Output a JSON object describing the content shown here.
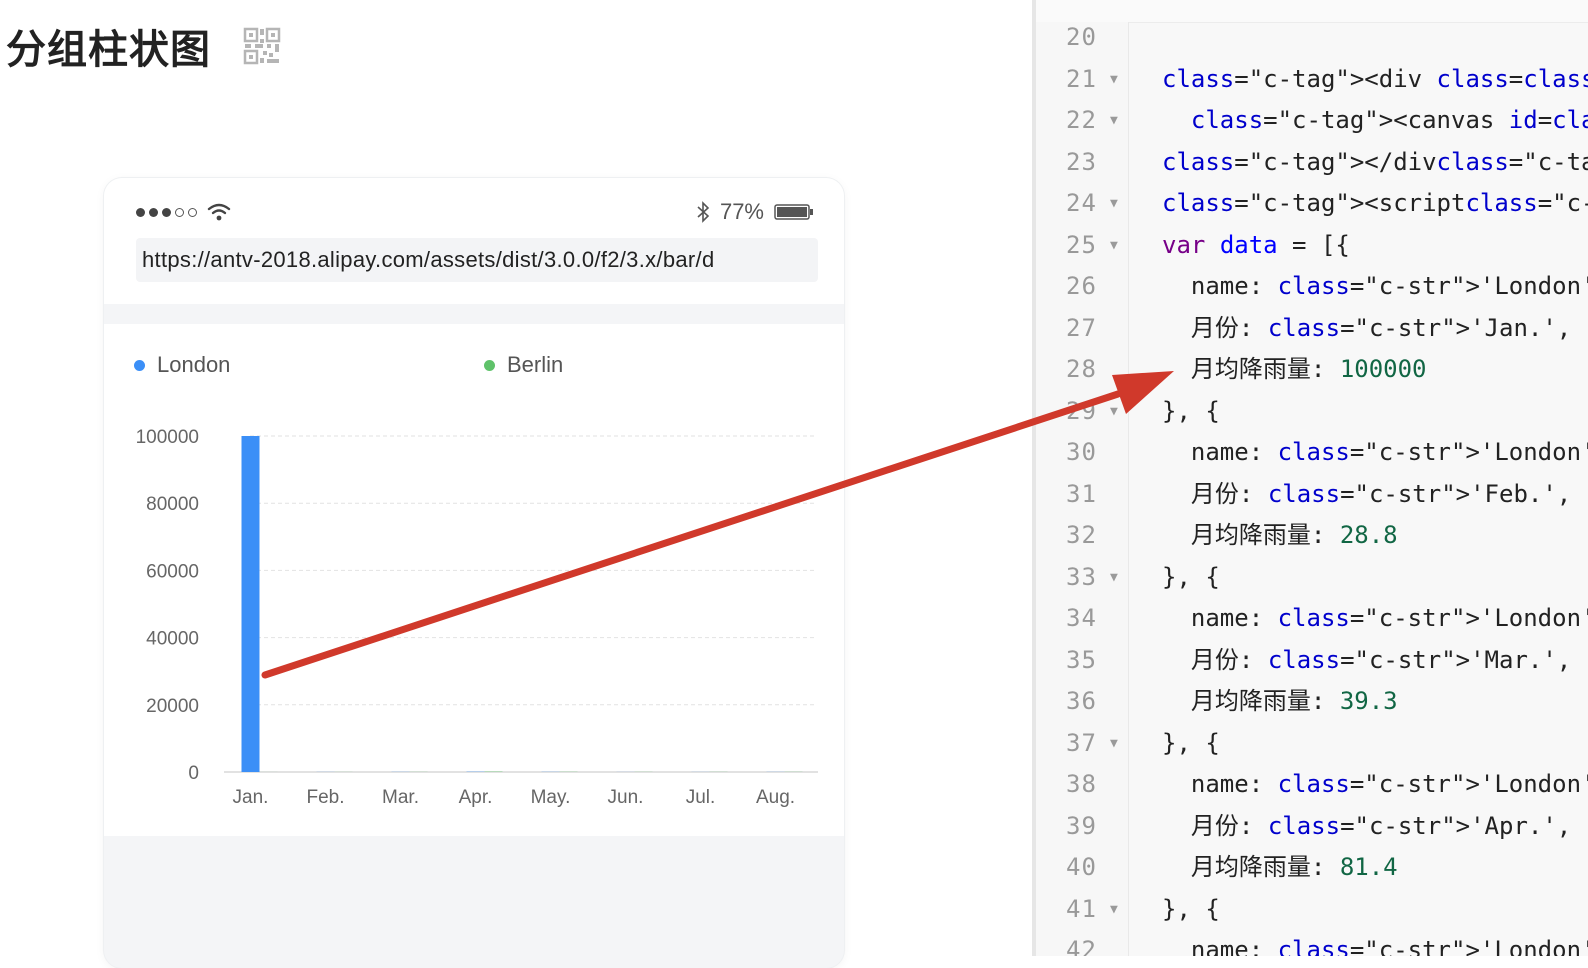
{
  "page": {
    "title": "分组柱状图",
    "qr_icon": "qr-code-icon"
  },
  "phone": {
    "status": {
      "signal_icon": "signal-dots-icon",
      "wifi_icon": "wifi-icon",
      "bluetooth_icon": "bluetooth-icon",
      "battery": "77%",
      "battery_icon": "battery-icon"
    },
    "url": "https://antv-2018.alipay.com/assets/dist/3.0.0/f2/3.x/bar/d"
  },
  "chart_data": {
    "type": "bar",
    "categories": [
      "Jan.",
      "Feb.",
      "Mar.",
      "Apr.",
      "May.",
      "Jun.",
      "Jul.",
      "Aug."
    ],
    "series": [
      {
        "name": "London",
        "color": "#3b8ff7",
        "values": [
          100000,
          28.8,
          39.3,
          81.4,
          47,
          20.3,
          24,
          35.6
        ]
      },
      {
        "name": "Berlin",
        "color": "#5fc26a",
        "values": [
          12.4,
          23.2,
          34.5,
          99.7,
          52.6,
          35.5,
          37.4,
          42.4
        ]
      }
    ],
    "yticks": [
      0,
      20000,
      40000,
      60000,
      80000,
      100000
    ],
    "ylim": [
      0,
      100000
    ],
    "grid": true,
    "legend_position": "top"
  },
  "code": {
    "lines": [
      {
        "num": "20",
        "fold": "",
        "text": ""
      },
      {
        "num": "21",
        "fold": "▼",
        "text": "<div class=\"chart-wrapper\">"
      },
      {
        "num": "22",
        "fold": "▼",
        "text": "  <canvas id=\"mountNode\">"
      },
      {
        "num": "23",
        "fold": "",
        "text": "</div>"
      },
      {
        "num": "24",
        "fold": "▼",
        "text": "<script>"
      },
      {
        "num": "25",
        "fold": "▼",
        "text": "var data = [{"
      },
      {
        "num": "26",
        "fold": "",
        "text": "  name: 'London',"
      },
      {
        "num": "27",
        "fold": "",
        "text": "  月份: 'Jan.',"
      },
      {
        "num": "28",
        "fold": "",
        "text": "  月均降雨量: 100000"
      },
      {
        "num": "29",
        "fold": "▼",
        "text": "}, {"
      },
      {
        "num": "30",
        "fold": "",
        "text": "  name: 'London',"
      },
      {
        "num": "31",
        "fold": "",
        "text": "  月份: 'Feb.',"
      },
      {
        "num": "32",
        "fold": "",
        "text": "  月均降雨量: 28.8"
      },
      {
        "num": "33",
        "fold": "▼",
        "text": "}, {"
      },
      {
        "num": "34",
        "fold": "",
        "text": "  name: 'London',"
      },
      {
        "num": "35",
        "fold": "",
        "text": "  月份: 'Mar.',"
      },
      {
        "num": "36",
        "fold": "",
        "text": "  月均降雨量: 39.3"
      },
      {
        "num": "37",
        "fold": "▼",
        "text": "}, {"
      },
      {
        "num": "38",
        "fold": "",
        "text": "  name: 'London',"
      },
      {
        "num": "39",
        "fold": "",
        "text": "  月份: 'Apr.',"
      },
      {
        "num": "40",
        "fold": "",
        "text": "  月均降雨量: 81.4"
      },
      {
        "num": "41",
        "fold": "▼",
        "text": "}, {"
      },
      {
        "num": "42",
        "fold": "",
        "text": "  name: 'London',"
      }
    ]
  },
  "annotation": {
    "arrow_color": "#d0392b"
  }
}
